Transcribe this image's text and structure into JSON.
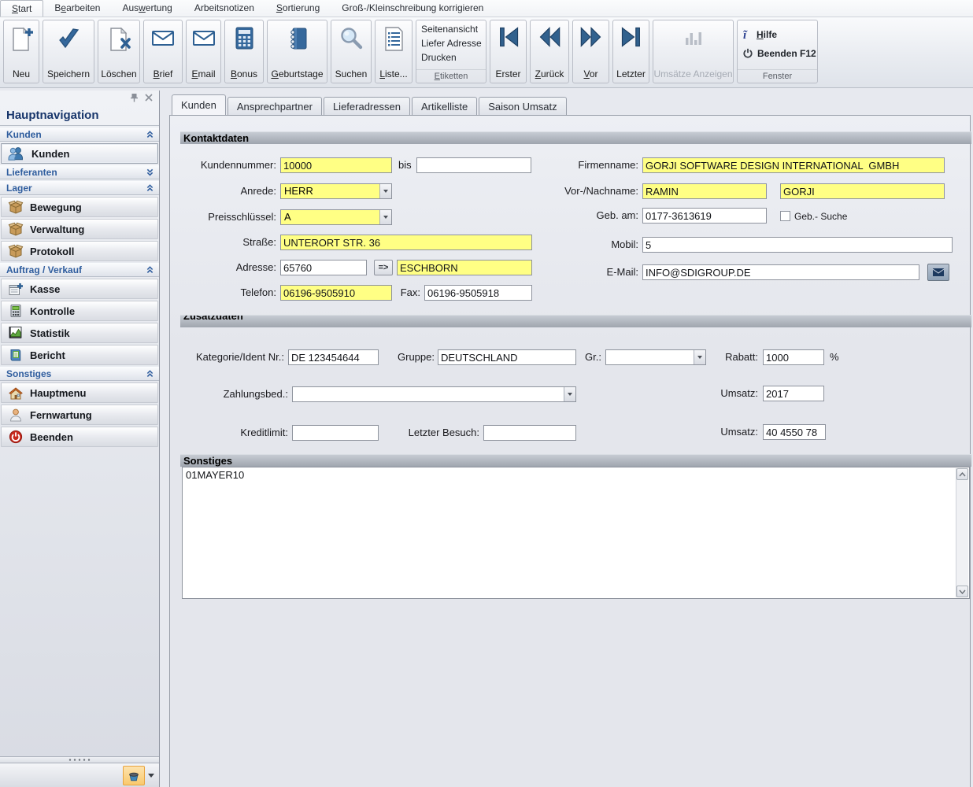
{
  "menu": {
    "items": [
      {
        "pre": "",
        "u": "S",
        "post": "tart"
      },
      {
        "pre": "B",
        "u": "e",
        "post": "arbeiten"
      },
      {
        "pre": "Aus",
        "u": "w",
        "post": "ertung"
      },
      {
        "pre": "Arbeitsnotizen",
        "u": "",
        "post": ""
      },
      {
        "pre": "",
        "u": "S",
        "post": "ortierung"
      },
      {
        "pre": "Groß-/Kleinschreibung korrigieren",
        "u": "",
        "post": ""
      }
    ]
  },
  "ribbon": {
    "buttons": [
      {
        "pre": "Neu",
        "u": "",
        "post": ""
      },
      {
        "pre": "Speichern",
        "u": "",
        "post": ""
      },
      {
        "pre": "Löschen",
        "u": "",
        "post": ""
      },
      {
        "pre": "",
        "u": "B",
        "post": "rief"
      },
      {
        "pre": "",
        "u": "E",
        "post": "mail"
      },
      {
        "pre": "",
        "u": "B",
        "post": "onus"
      },
      {
        "pre": "",
        "u": "G",
        "post": "eburtstage"
      },
      {
        "pre": "Suchen",
        "u": "",
        "post": ""
      },
      {
        "pre": "",
        "u": "L",
        "post": "iste..."
      }
    ],
    "print_group": {
      "items": [
        "Seitenansicht",
        "Liefer Adresse",
        "Drucken"
      ],
      "caption_pre": "",
      "caption_u": "E",
      "caption_post": "tiketten"
    },
    "nav": [
      {
        "pre": "Erster",
        "u": "",
        "post": ""
      },
      {
        "pre": "",
        "u": "Z",
        "post": "urück"
      },
      {
        "pre": "",
        "u": "V",
        "post": "or"
      },
      {
        "pre": "Letzter",
        "u": "",
        "post": ""
      }
    ],
    "umsaetze_label": "Umsätze Anzeigen",
    "window_group": {
      "hilfe_pre": "",
      "hilfe_u": "H",
      "hilfe_post": "ilfe",
      "beenden": "Beenden F12",
      "caption": "Fenster"
    }
  },
  "sidebar": {
    "title": "Hauptnavigation",
    "groups": [
      {
        "label": "Kunden"
      },
      {
        "label": "Lieferanten"
      },
      {
        "label": "Lager"
      },
      {
        "label": "Auftrag / Verkauf"
      },
      {
        "label": "Sonstiges"
      }
    ],
    "items": [
      {
        "label": "Kunden"
      },
      {
        "label": "Bewegung"
      },
      {
        "label": "Verwaltung"
      },
      {
        "label": "Protokoll"
      },
      {
        "label": "Kasse"
      },
      {
        "label": "Kontrolle"
      },
      {
        "label": "Statistik"
      },
      {
        "label": "Bericht"
      },
      {
        "label": "Hauptmenu"
      },
      {
        "label": "Fernwartung"
      },
      {
        "label": "Beenden"
      }
    ]
  },
  "tabs": [
    {
      "label": "Kunden"
    },
    {
      "label": "Ansprechpartner"
    },
    {
      "label": "Lieferadressen"
    },
    {
      "label": "Artikelliste"
    },
    {
      "label": "Saison Umsatz"
    }
  ],
  "form": {
    "kontaktdaten": {
      "title": "Kontaktdaten",
      "kundennummer_label": "Kundennummer:",
      "kundennummer": "10000",
      "bis_label": "bis",
      "kundennummer_bis": "",
      "anrede_label": "Anrede:",
      "anrede": "HERR",
      "preisschluessel_label": "Preisschlüssel:",
      "preisschluessel": "A",
      "strasse_label": "Straße:",
      "strasse": "UNTERORT STR. 36",
      "adresse_label": "Adresse:",
      "plz": "65760",
      "arrow_button": "=>",
      "ort": "ESCHBORN",
      "telefon_label": "Telefon:",
      "telefon": "06196-9505910",
      "fax_label": "Fax:",
      "fax": "06196-9505918",
      "firmenname_label": "Firmenname:",
      "firmenname": "GORJI SOFTWARE DESIGN INTERNATIONAL  GMBH",
      "name_label": "Vor-/Nachname:",
      "vorname": "RAMIN",
      "nachname": "GORJI",
      "geb_label": "Geb. am:",
      "geb": "0177-3613619",
      "geb_suche_label": "Geb.- Suche",
      "mobil_label": "Mobil:",
      "mobil": "5",
      "email_label": "E-Mail:",
      "email": "INFO@SDIGROUP.DE"
    },
    "zusatzdaten": {
      "title": "Zusatzdaten",
      "kategorie_label": "Kategorie/Ident Nr.:",
      "kategorie": "DE 123454644",
      "gruppe_label": "Gruppe:",
      "gruppe": "DEUTSCHLAND",
      "gr_label": "Gr.:",
      "gr": "",
      "rabatt_label": "Rabatt:",
      "rabatt": "1000",
      "rabatt_unit": "%",
      "zahlungsbed_label": "Zahlungsbed.:",
      "zahlungsbed": "",
      "umsatz_jahr_label": "Umsatz:",
      "umsatz_jahr": "2017",
      "kreditlimit_label": "Kreditlimit:",
      "kreditlimit": "",
      "letzter_besuch_label": "Letzter Besuch:",
      "letzter_besuch": "",
      "umsatz_label": "Umsatz:",
      "umsatz": "40 4550 78"
    },
    "sonstiges": {
      "title": "Sonstiges",
      "text": "01MAYER10"
    }
  },
  "colors": {
    "field_highlight": "#ffff84",
    "accent_blue": "#2f5d9e",
    "icon_steel_blue": "#31618e"
  }
}
